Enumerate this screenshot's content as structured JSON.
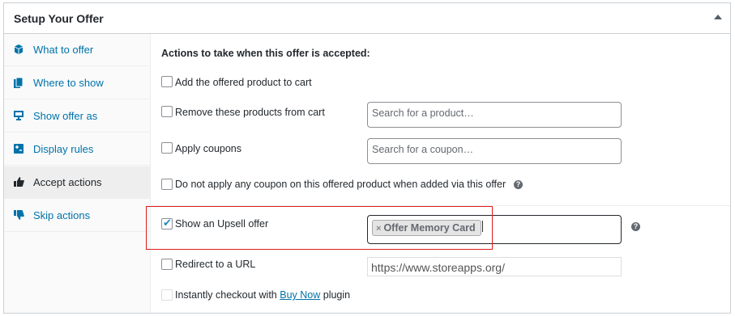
{
  "panel": {
    "title": "Setup Your Offer"
  },
  "sidebar": {
    "items": [
      {
        "label": "What to offer",
        "icon": "cube-icon"
      },
      {
        "label": "Where to show",
        "icon": "pages-icon"
      },
      {
        "label": "Show offer as",
        "icon": "monitor-icon"
      },
      {
        "label": "Display rules",
        "icon": "rules-icon"
      },
      {
        "label": "Accept actions",
        "icon": "thumbs-up-icon",
        "active": true
      },
      {
        "label": "Skip actions",
        "icon": "thumbs-down-icon"
      }
    ]
  },
  "content": {
    "heading": "Actions to take when this offer is accepted:",
    "actions": {
      "add_product": {
        "label": "Add the offered product to cart",
        "checked": false
      },
      "remove_products": {
        "label": "Remove these products from cart",
        "placeholder": "Search for a product…",
        "checked": false
      },
      "apply_coupons": {
        "label": "Apply coupons",
        "placeholder": "Search for a coupon…",
        "checked": false
      },
      "no_coupon": {
        "label": "Do not apply any coupon on this offered product when added via this offer",
        "checked": false
      },
      "upsell": {
        "label": "Show an Upsell offer",
        "checked": true,
        "chip": "Offer Memory Card",
        "chip_remove": "×"
      },
      "redirect": {
        "label": "Redirect to a URL",
        "value": "https://www.storeapps.org/",
        "checked": false
      },
      "instant_checkout": {
        "prefix": "Instantly checkout with ",
        "link": "Buy Now",
        "suffix": " plugin",
        "checked": false
      }
    }
  },
  "colors": {
    "link": "#0073aa",
    "highlight": "#e01b1b",
    "check": "#1e8cbe"
  }
}
